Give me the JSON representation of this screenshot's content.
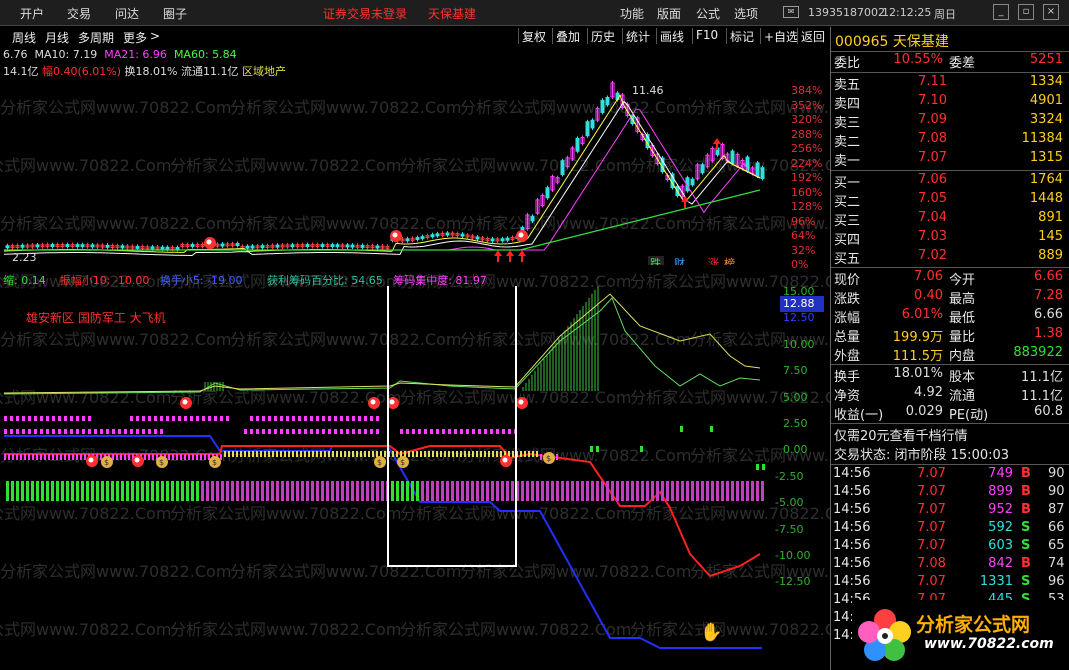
{
  "menu": [
    "开户",
    "交易",
    "问达",
    "圈子"
  ],
  "login_status": "证券交易未登录",
  "stock_title": "天保基建",
  "top_right": [
    "功能",
    "版面",
    "公式",
    "选项"
  ],
  "phone": "13935187002",
  "clock": "12:12:25",
  "weekday": "周日",
  "window_buttons": [
    "_",
    "▫",
    "×"
  ],
  "period_tools": [
    "周线",
    "月线",
    "多周期",
    "更多"
  ],
  "right_tools": [
    "复权",
    "叠加",
    "历史",
    "统计",
    "画线",
    "F10",
    "标记",
    "+自选",
    "返回"
  ],
  "ma_line": {
    "price": "6.76",
    "ma10": "MA10: 7.19",
    "ma21": "MA21: 6.96",
    "ma60": "MA60: 5.84"
  },
  "info_line": {
    "amount": "14.1亿",
    "change": "幅0.40(6.01%)",
    "turnover": "换18.01%",
    "float": "流通11.1亿",
    "sector": "区域地产"
  },
  "chart_data": [
    {
      "type": "candlestick",
      "high_label": "11.46",
      "low_label": "2.23",
      "y_ticks": [
        "384%",
        "352%",
        "320%",
        "288%",
        "256%",
        "224%",
        "192%",
        "160%",
        "128%",
        "96%",
        "64%",
        "32%",
        "0%"
      ],
      "markers": [
        "跌",
        "财",
        "涨",
        "榜"
      ]
    },
    {
      "type": "line",
      "labels": [
        "缩: 0.14",
        "振幅小10: -10.00",
        "换手小5: -19.00",
        "获利筹码百分比: 54.65",
        "筹码集中度: 81.97"
      ],
      "concept_text": "雄安新区 国防军工 大飞机",
      "current_value": "12.88",
      "y_ticks": [
        "15.00",
        "12.50",
        "10.00",
        "7.50",
        "5.00",
        "2.50",
        "0.00",
        "-2.50",
        "-5.00",
        "-7.50",
        "-10.00",
        "-12.50"
      ]
    }
  ],
  "quote": {
    "code_name": "000965 天保基建",
    "weibi_label": "委比",
    "weibi": "10.55%",
    "weicha_label": "委差",
    "weicha": "5251",
    "asks": [
      {
        "l": "卖五",
        "p": "7.11",
        "v": "1334"
      },
      {
        "l": "卖四",
        "p": "7.10",
        "v": "4901"
      },
      {
        "l": "卖三",
        "p": "7.09",
        "v": "3324"
      },
      {
        "l": "卖二",
        "p": "7.08",
        "v": "11384"
      },
      {
        "l": "卖一",
        "p": "7.07",
        "v": "1315"
      }
    ],
    "bids": [
      {
        "l": "买一",
        "p": "7.06",
        "v": "1764"
      },
      {
        "l": "买二",
        "p": "7.05",
        "v": "1448"
      },
      {
        "l": "买三",
        "p": "7.04",
        "v": "891"
      },
      {
        "l": "买四",
        "p": "7.03",
        "v": "145"
      },
      {
        "l": "买五",
        "p": "7.02",
        "v": "889"
      }
    ],
    "stats": [
      {
        "l": "现价",
        "v": "7.06",
        "l2": "今开",
        "v2": "6.66"
      },
      {
        "l": "涨跌",
        "v": "0.40",
        "l2": "最高",
        "v2": "7.28"
      },
      {
        "l": "涨幅",
        "v": "6.01%",
        "l2": "最低",
        "v2": "6.66"
      },
      {
        "l": "总量",
        "v": "199.9万",
        "l2": "量比",
        "v2": "1.38"
      },
      {
        "l": "外盘",
        "v": "111.5万",
        "l2": "内盘",
        "v2": "883922"
      }
    ],
    "stats2": [
      {
        "l": "换手",
        "v": "18.01%",
        "l2": "股本",
        "v2": "11.1亿"
      },
      {
        "l": "净资",
        "v": "4.92",
        "l2": "流通",
        "v2": "11.1亿"
      },
      {
        "l": "收益(一)",
        "v": "0.029",
        "l2": "PE(动)",
        "v2": "60.8"
      }
    ],
    "promo": "仅需20元查看千档行情",
    "trade_state": "交易状态: 闭市阶段 15:00:03",
    "ticks": [
      {
        "t": "14:56",
        "p": "7.07",
        "v": "749",
        "s": "B",
        "n": "90"
      },
      {
        "t": "14:56",
        "p": "7.07",
        "v": "899",
        "s": "B",
        "n": "90"
      },
      {
        "t": "14:56",
        "p": "7.07",
        "v": "952",
        "s": "B",
        "n": "87"
      },
      {
        "t": "14:56",
        "p": "7.07",
        "v": "592",
        "s": "S",
        "n": "66"
      },
      {
        "t": "14:56",
        "p": "7.07",
        "v": "603",
        "s": "S",
        "n": "65"
      },
      {
        "t": "14:56",
        "p": "7.08",
        "v": "842",
        "s": "B",
        "n": "74"
      },
      {
        "t": "14:56",
        "p": "7.07",
        "v": "1331",
        "s": "S",
        "n": "96"
      },
      {
        "t": "14:56",
        "p": "7.07",
        "v": "445",
        "s": "S",
        "n": "53"
      },
      {
        "t": "14:5",
        "p": "",
        "v": "",
        "s": "",
        "n": ""
      },
      {
        "t": "14:5",
        "p": "",
        "v": "",
        "s": "",
        "n": ""
      }
    ]
  },
  "watermark": "分析家公式网www.70822.Com",
  "logo": {
    "title": "分析家公式网",
    "url": "www.70822.com"
  }
}
